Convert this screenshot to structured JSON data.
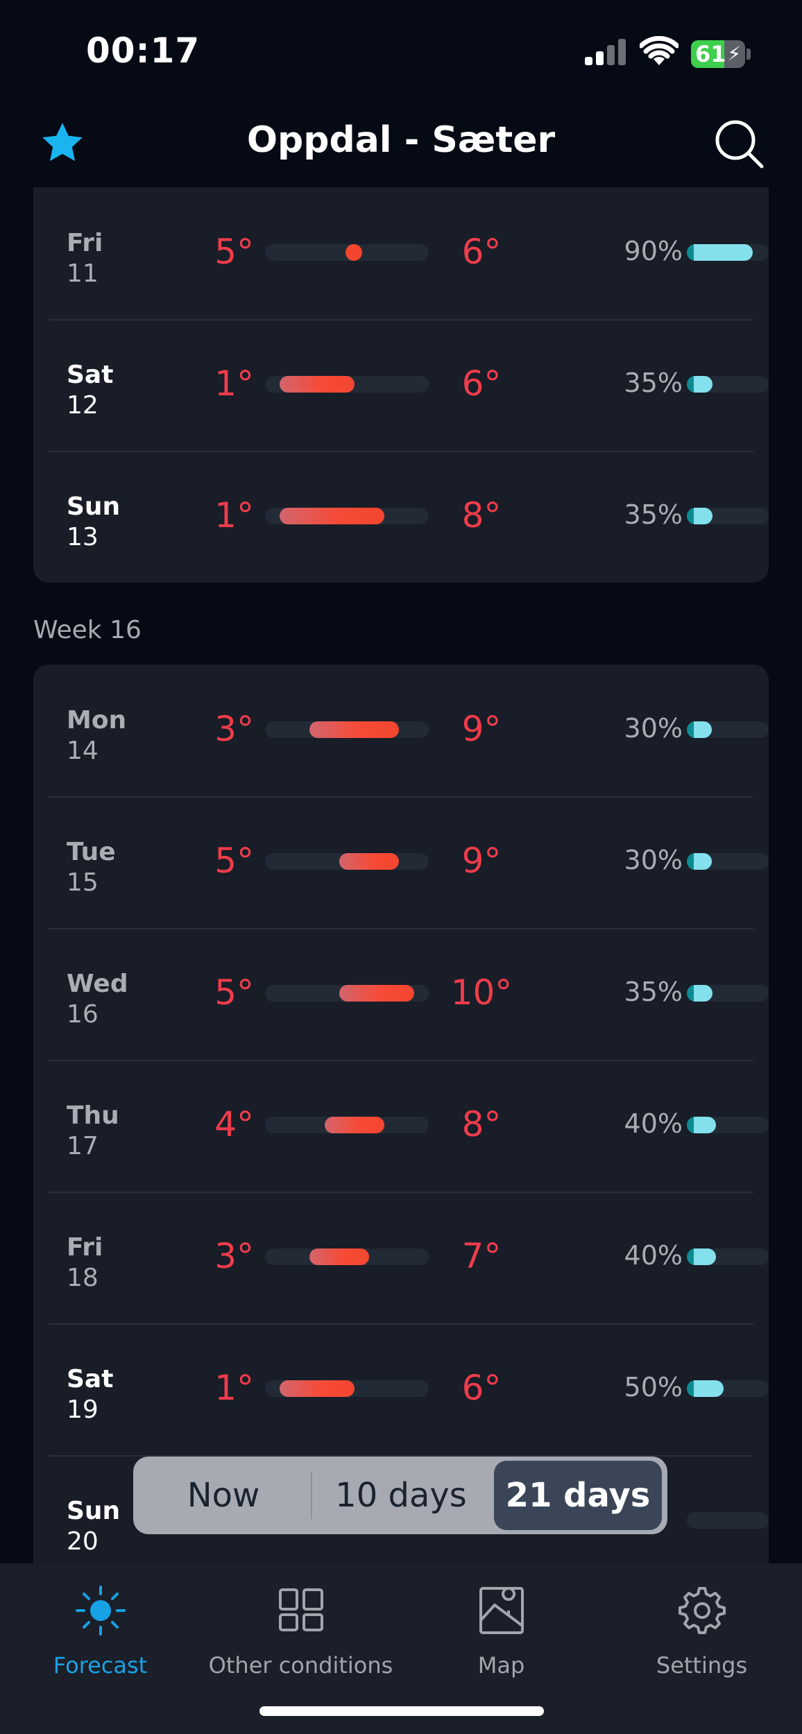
{
  "status": {
    "time": "00:17",
    "battery": "61"
  },
  "header": {
    "title": "Oppdal - Sæter"
  },
  "weeks": [
    {
      "label": "",
      "days": [
        {
          "name": "Fri",
          "date": "11",
          "min": "5°",
          "max": "6°",
          "precip": "90%",
          "weekend": false
        },
        {
          "name": "Sat",
          "date": "12",
          "min": "1°",
          "max": "6°",
          "precip": "35%",
          "weekend": true
        },
        {
          "name": "Sun",
          "date": "13",
          "min": "1°",
          "max": "8°",
          "precip": "35%",
          "weekend": true
        }
      ]
    },
    {
      "label": "Week 16",
      "days": [
        {
          "name": "Mon",
          "date": "14",
          "min": "3°",
          "max": "9°",
          "precip": "30%",
          "weekend": false
        },
        {
          "name": "Tue",
          "date": "15",
          "min": "5°",
          "max": "9°",
          "precip": "30%",
          "weekend": false
        },
        {
          "name": "Wed",
          "date": "16",
          "min": "5°",
          "max": "10°",
          "precip": "35%",
          "weekend": false
        },
        {
          "name": "Thu",
          "date": "17",
          "min": "4°",
          "max": "8°",
          "precip": "40%",
          "weekend": false
        },
        {
          "name": "Fri",
          "date": "18",
          "min": "3°",
          "max": "7°",
          "precip": "40%",
          "weekend": false
        },
        {
          "name": "Sat",
          "date": "19",
          "min": "1°",
          "max": "6°",
          "precip": "50%",
          "weekend": true
        },
        {
          "name": "Sun",
          "date": "20",
          "min": "",
          "max": "",
          "precip": "",
          "weekend": true
        }
      ]
    }
  ],
  "range_toggle": {
    "options": [
      "Now",
      "10 days",
      "21 days"
    ],
    "selected": "21 days"
  },
  "tabs": [
    {
      "label": "Forecast",
      "icon": "sun-icon",
      "active": true
    },
    {
      "label": "Other conditions",
      "icon": "grid-icon",
      "active": false
    },
    {
      "label": "Map",
      "icon": "map-icon",
      "active": false
    },
    {
      "label": "Settings",
      "icon": "gear-icon",
      "active": false
    }
  ],
  "colors": {
    "temperature": "#f03c4b",
    "accent": "#18a2e6",
    "precipitation": "#84e0ec",
    "card": "#181d27",
    "background": "#050a14"
  }
}
